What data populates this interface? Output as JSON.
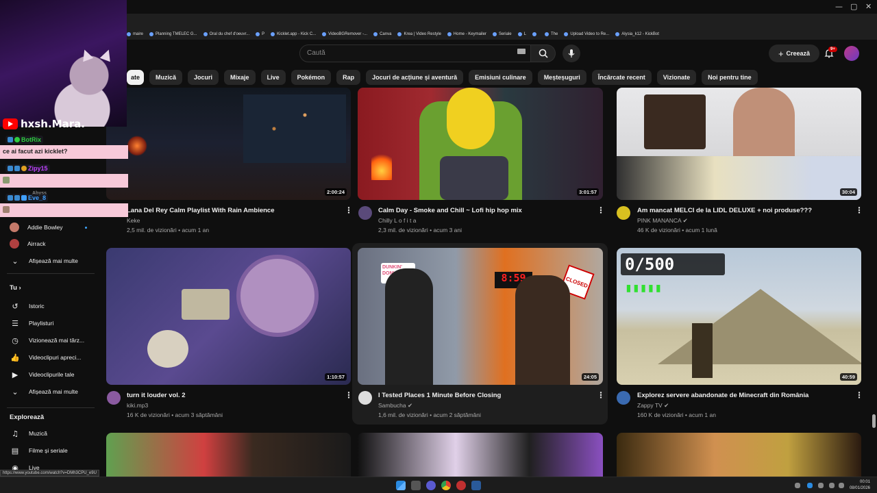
{
  "browser": {
    "window_controls": [
      "—",
      "▢",
      "✕"
    ],
    "bookmarks": [
      {
        "label": "maire"
      },
      {
        "label": "Planning TMELEC G..."
      },
      {
        "label": "Oral du chef d'oeuvr..."
      },
      {
        "label": "P"
      },
      {
        "label": "Kicklet.app - Kick C..."
      },
      {
        "label": "VideoBGRemover -..."
      },
      {
        "label": "Canva"
      },
      {
        "label": "Krea | Video Restyle"
      },
      {
        "label": "Home - Keymailer"
      },
      {
        "label": "Seriale"
      },
      {
        "label": "L"
      },
      {
        "label": ""
      },
      {
        "label": "The"
      },
      {
        "label": "Upload Video to Re..."
      },
      {
        "label": "Alysia_k12 - KickBot"
      }
    ],
    "status_url": "https://www.youtube.com/watch?v=DMh3CPU_e9U"
  },
  "header": {
    "search_placeholder": "Caută",
    "create_label": "Creează",
    "notif_badge": "9+"
  },
  "chips": [
    {
      "label": "ate",
      "active": true
    },
    {
      "label": "Muzică"
    },
    {
      "label": "Jocuri"
    },
    {
      "label": "Mixaje"
    },
    {
      "label": "Live"
    },
    {
      "label": "Pokémon"
    },
    {
      "label": "Rap"
    },
    {
      "label": "Jocuri de acțiune și aventură"
    },
    {
      "label": "Emisiuni culinare"
    },
    {
      "label": "Meșteșuguri"
    },
    {
      "label": "Încărcate recent"
    },
    {
      "label": "Vizionate"
    },
    {
      "label": "Noi pentru tine"
    }
  ],
  "sidebar": {
    "subs": [
      {
        "label": "Addie Bowley",
        "color": "#c47a6a"
      },
      {
        "label": "Airrack",
        "color": "#b04040"
      }
    ],
    "show_more_1": "Afișează mai multe",
    "you_heading": "Tu",
    "you_items": [
      {
        "label": "Istoric",
        "icon": "history-icon",
        "glyph": "↺"
      },
      {
        "label": "Playlisturi",
        "icon": "playlist-icon",
        "glyph": "☰"
      },
      {
        "label": "Vizionează mai târz...",
        "icon": "clock-icon",
        "glyph": "◷"
      },
      {
        "label": "Videoclipuri apreci...",
        "icon": "thumbs-up-icon",
        "glyph": "👍"
      },
      {
        "label": "Videoclipurile tale",
        "icon": "your-videos-icon",
        "glyph": "▶"
      },
      {
        "label": "Afișează mai multe",
        "icon": "chevron-down-icon",
        "glyph": "⌄"
      }
    ],
    "explore_heading": "Explorează",
    "explore_items": [
      {
        "label": "Muzică",
        "icon": "music-icon",
        "glyph": "♫"
      },
      {
        "label": "Filme și seriale",
        "icon": "film-icon",
        "glyph": "▤"
      },
      {
        "label": "Live",
        "icon": "live-icon",
        "glyph": "◉"
      }
    ]
  },
  "videos": [
    {
      "title": "Lana Del Rey Calm Playlist With Rain Ambience",
      "channel": "Keke",
      "meta": "2,5 mil. de vizionări • acum 1 an",
      "duration": "2:00:24",
      "verified": false,
      "avatar": "#333"
    },
    {
      "title": "Calm Day - Smoke and Chill ~ Lofi hip hop mix",
      "channel": "Chilly L o f i t a",
      "meta": "2,3 mil. de vizionări • acum 3 ani",
      "duration": "3:01:57",
      "verified": false,
      "avatar": "#5a4a7a"
    },
    {
      "title": "Am mancat MELCI de la LIDL DELUXE + noi produse???",
      "channel": "PINK MANANCA",
      "meta": "46 K de vizionări • acum 1 lună",
      "duration": "30:04",
      "verified": true,
      "avatar": "#d8c020"
    },
    {
      "title": "turn it louder vol. 2",
      "channel": "kiki.mp3",
      "meta": "16 K de vizionări • acum 3 săptămâni",
      "duration": "1:10:57",
      "verified": false,
      "avatar": "#8a5aa0"
    },
    {
      "title": "I Tested Places 1 Minute Before Closing",
      "channel": "Sambucha",
      "meta": "1,6 mil. de vizionări • acum 2 săptămâni",
      "duration": "24:05",
      "verified": true,
      "avatar": "#ddd"
    },
    {
      "title": "Explorez servere abandonate de Minecraft din România",
      "channel": "Zappy TV",
      "meta": "160 K de vizionări • acum 1 an",
      "duration": "40:59",
      "verified": true,
      "avatar": "#3a6ab0"
    }
  ],
  "thumb_text": {
    "dunkin": "DUNKIN' DONUTS",
    "clock": "8:59",
    "closed": "CLOSED",
    "mc_counter": "0/500"
  },
  "stream_overlay": {
    "streamer_name": "hxsh.Mara.",
    "chat": [
      {
        "user": "BotRix",
        "color": "#2ecc40",
        "message": "ce ai facut azi kicklet?"
      },
      {
        "user": "Zipy15",
        "color": "#c040ff",
        "message": ""
      },
      {
        "user": "Abyss",
        "color": "#888",
        "message": ""
      },
      {
        "user": "Eve_8",
        "color": "#40a0ff",
        "message": ""
      }
    ]
  },
  "taskbar": {
    "time": "00:01",
    "date": "08/01/2026"
  }
}
